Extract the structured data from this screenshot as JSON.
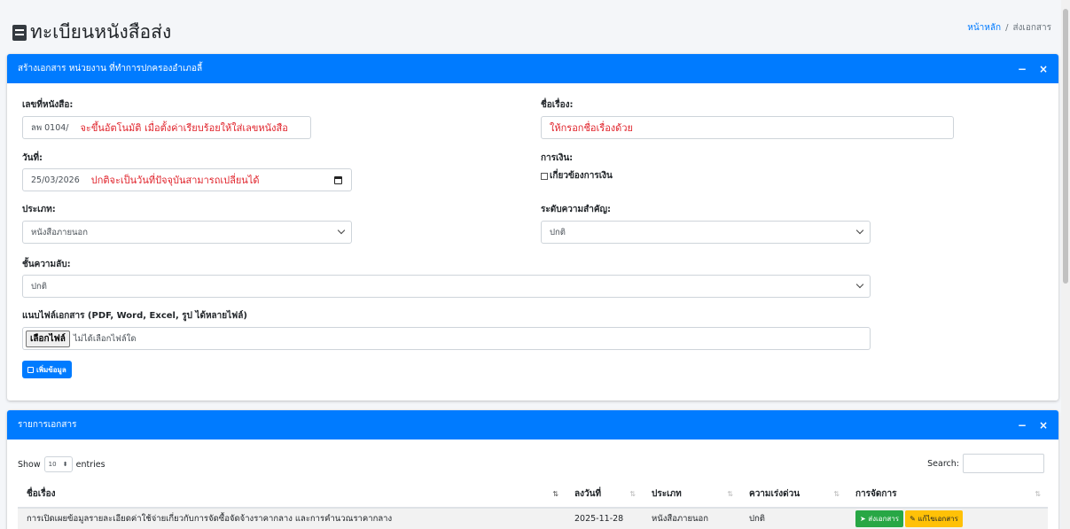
{
  "page": {
    "title": "ทะเบียนหนังสือส่ง",
    "breadcrumb": {
      "home": "หน้าหลัก",
      "separator": "/",
      "current": "ส่งเอกสาร"
    }
  },
  "form_card": {
    "title": "สร้างเอกสาร หน่วยงาน ที่ทำการปกครองอำเภอลี้",
    "minimize": "−",
    "close": "×",
    "doc_no": {
      "label": "เลขที่หนังสือ:",
      "value": "ลพ 0104/",
      "note": "จะขึ้นอัตโนมัติ เมื่อตั้งค่าเรียบร้อยให้ใส่เลขหนังสือ"
    },
    "subject": {
      "label": "ชื่อเรื่อง:",
      "placeholder": "ให้กรอกชื่อเรื่องด้วย"
    },
    "date": {
      "label": "วันที่:",
      "value": "25/03/2026",
      "note": "ปกติจะเป็นวันที่ปัจจุบันสามารถเปลี่ยนได้"
    },
    "finance": {
      "label": "การเงิน:",
      "checkbox_label": "เกี่ยวข้องการเงิน"
    },
    "type": {
      "label": "ประเภท:",
      "value": "หนังสือภายนอก"
    },
    "priority": {
      "label": "ระดับความสำคัญ:",
      "value": "ปกติ"
    },
    "secrecy": {
      "label": "ชั้นความลับ:",
      "value": "ปกติ"
    },
    "attachment": {
      "label": "แนบไฟล์เอกสาร (PDF, Word, Excel, รูป ได้หลายไฟล์)",
      "button": "เลือกไฟล์",
      "status": "ไม่ได้เลือกไฟล์ใด"
    },
    "submit_label": "เพิ่มข้อมูล"
  },
  "list_card": {
    "title": "รายการเอกสาร",
    "minimize": "−",
    "close": "×",
    "show_label": "Show",
    "page_length": "10",
    "entries_label": "entries",
    "search_label": "Search:",
    "columns": [
      "ชื่อเรื่อง",
      "ลงวันที่",
      "ประเภท",
      "ความเร่งด่วน",
      "การจัดการ"
    ],
    "rows": [
      {
        "subject": "การเปิดเผยข้อมูลรายละเอียดค่าใช้จ่ายเกี่ยวกับการจัดซื้อจัดจ้างราคากลาง และการคำนวณราคากลาง",
        "date": "2025-11-28",
        "type": "หนังสือภายนอก",
        "urgency": "ปกติ",
        "send_label": "ส่งเอกสาร",
        "edit_label": "แก้ไขเอกสาร"
      }
    ]
  }
}
